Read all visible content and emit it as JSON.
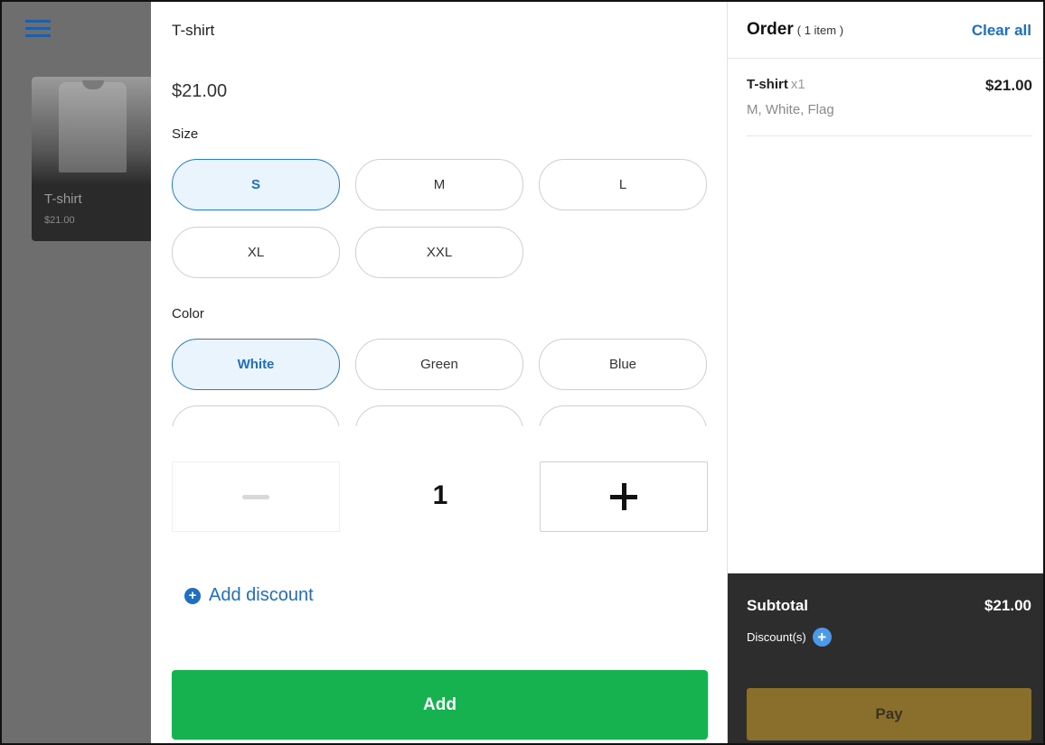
{
  "background": {
    "product_card": {
      "title": "T-shirt",
      "price": "$21.00"
    }
  },
  "modal": {
    "title": "T-shirt",
    "price": "$21.00",
    "size": {
      "label": "Size",
      "options": [
        "S",
        "M",
        "L",
        "XL",
        "XXL"
      ],
      "selected": "S"
    },
    "color": {
      "label": "Color",
      "options": [
        "White",
        "Green",
        "Blue"
      ],
      "selected": "White"
    },
    "quantity": "1",
    "add_discount_label": "Add discount",
    "add_button_label": "Add"
  },
  "order": {
    "title": "Order",
    "count": "( 1 item )",
    "clear_all_label": "Clear all",
    "items": [
      {
        "name": "T-shirt",
        "qty": "x1",
        "price": "$21.00",
        "modifiers": "M, White, Flag"
      }
    ],
    "subtotal_label": "Subtotal",
    "subtotal_value": "$21.00",
    "discounts_label": "Discount(s)",
    "pay_label": "Pay"
  },
  "colors": {
    "accent_blue": "#1e6fbf",
    "add_green": "#15b24f",
    "pay_gold": "#8a6f2c",
    "summary_dark": "#2d2d2d"
  }
}
